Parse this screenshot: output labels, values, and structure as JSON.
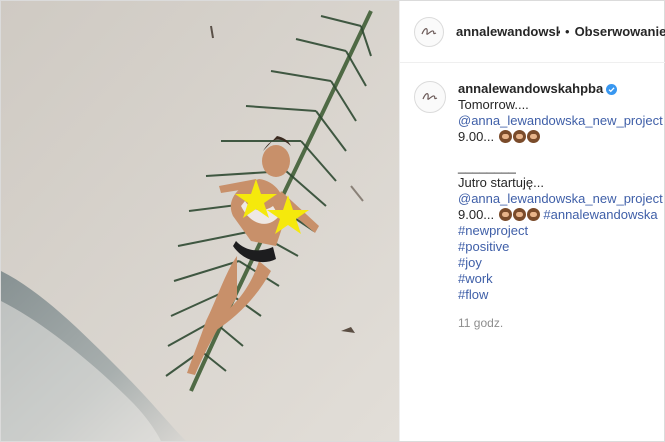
{
  "header": {
    "username": "annalewandowskahpba",
    "separator": "•",
    "follow_label": "Obserwowanie"
  },
  "caption": {
    "username": "annalewandowskahpba",
    "lines": [
      "Tomorrow....",
      "@anna_lewandowska_new_project",
      "9.00...",
      "________",
      "Jutro startuję...",
      "@anna_lewandowska_new_project",
      "9.00...",
      "#annalewandowska",
      "#newproject",
      "#positive",
      "#joy",
      "#work",
      "#flow"
    ],
    "timestamp": "11 godz."
  },
  "icons": {
    "verified": "verified-badge-icon",
    "emoji": "see-no-evil-monkey-emoji",
    "censor": "star-icon"
  },
  "colors": {
    "link": "#3f5fa8",
    "verified": "#3897f0",
    "censor_star": "#f5e90c"
  }
}
